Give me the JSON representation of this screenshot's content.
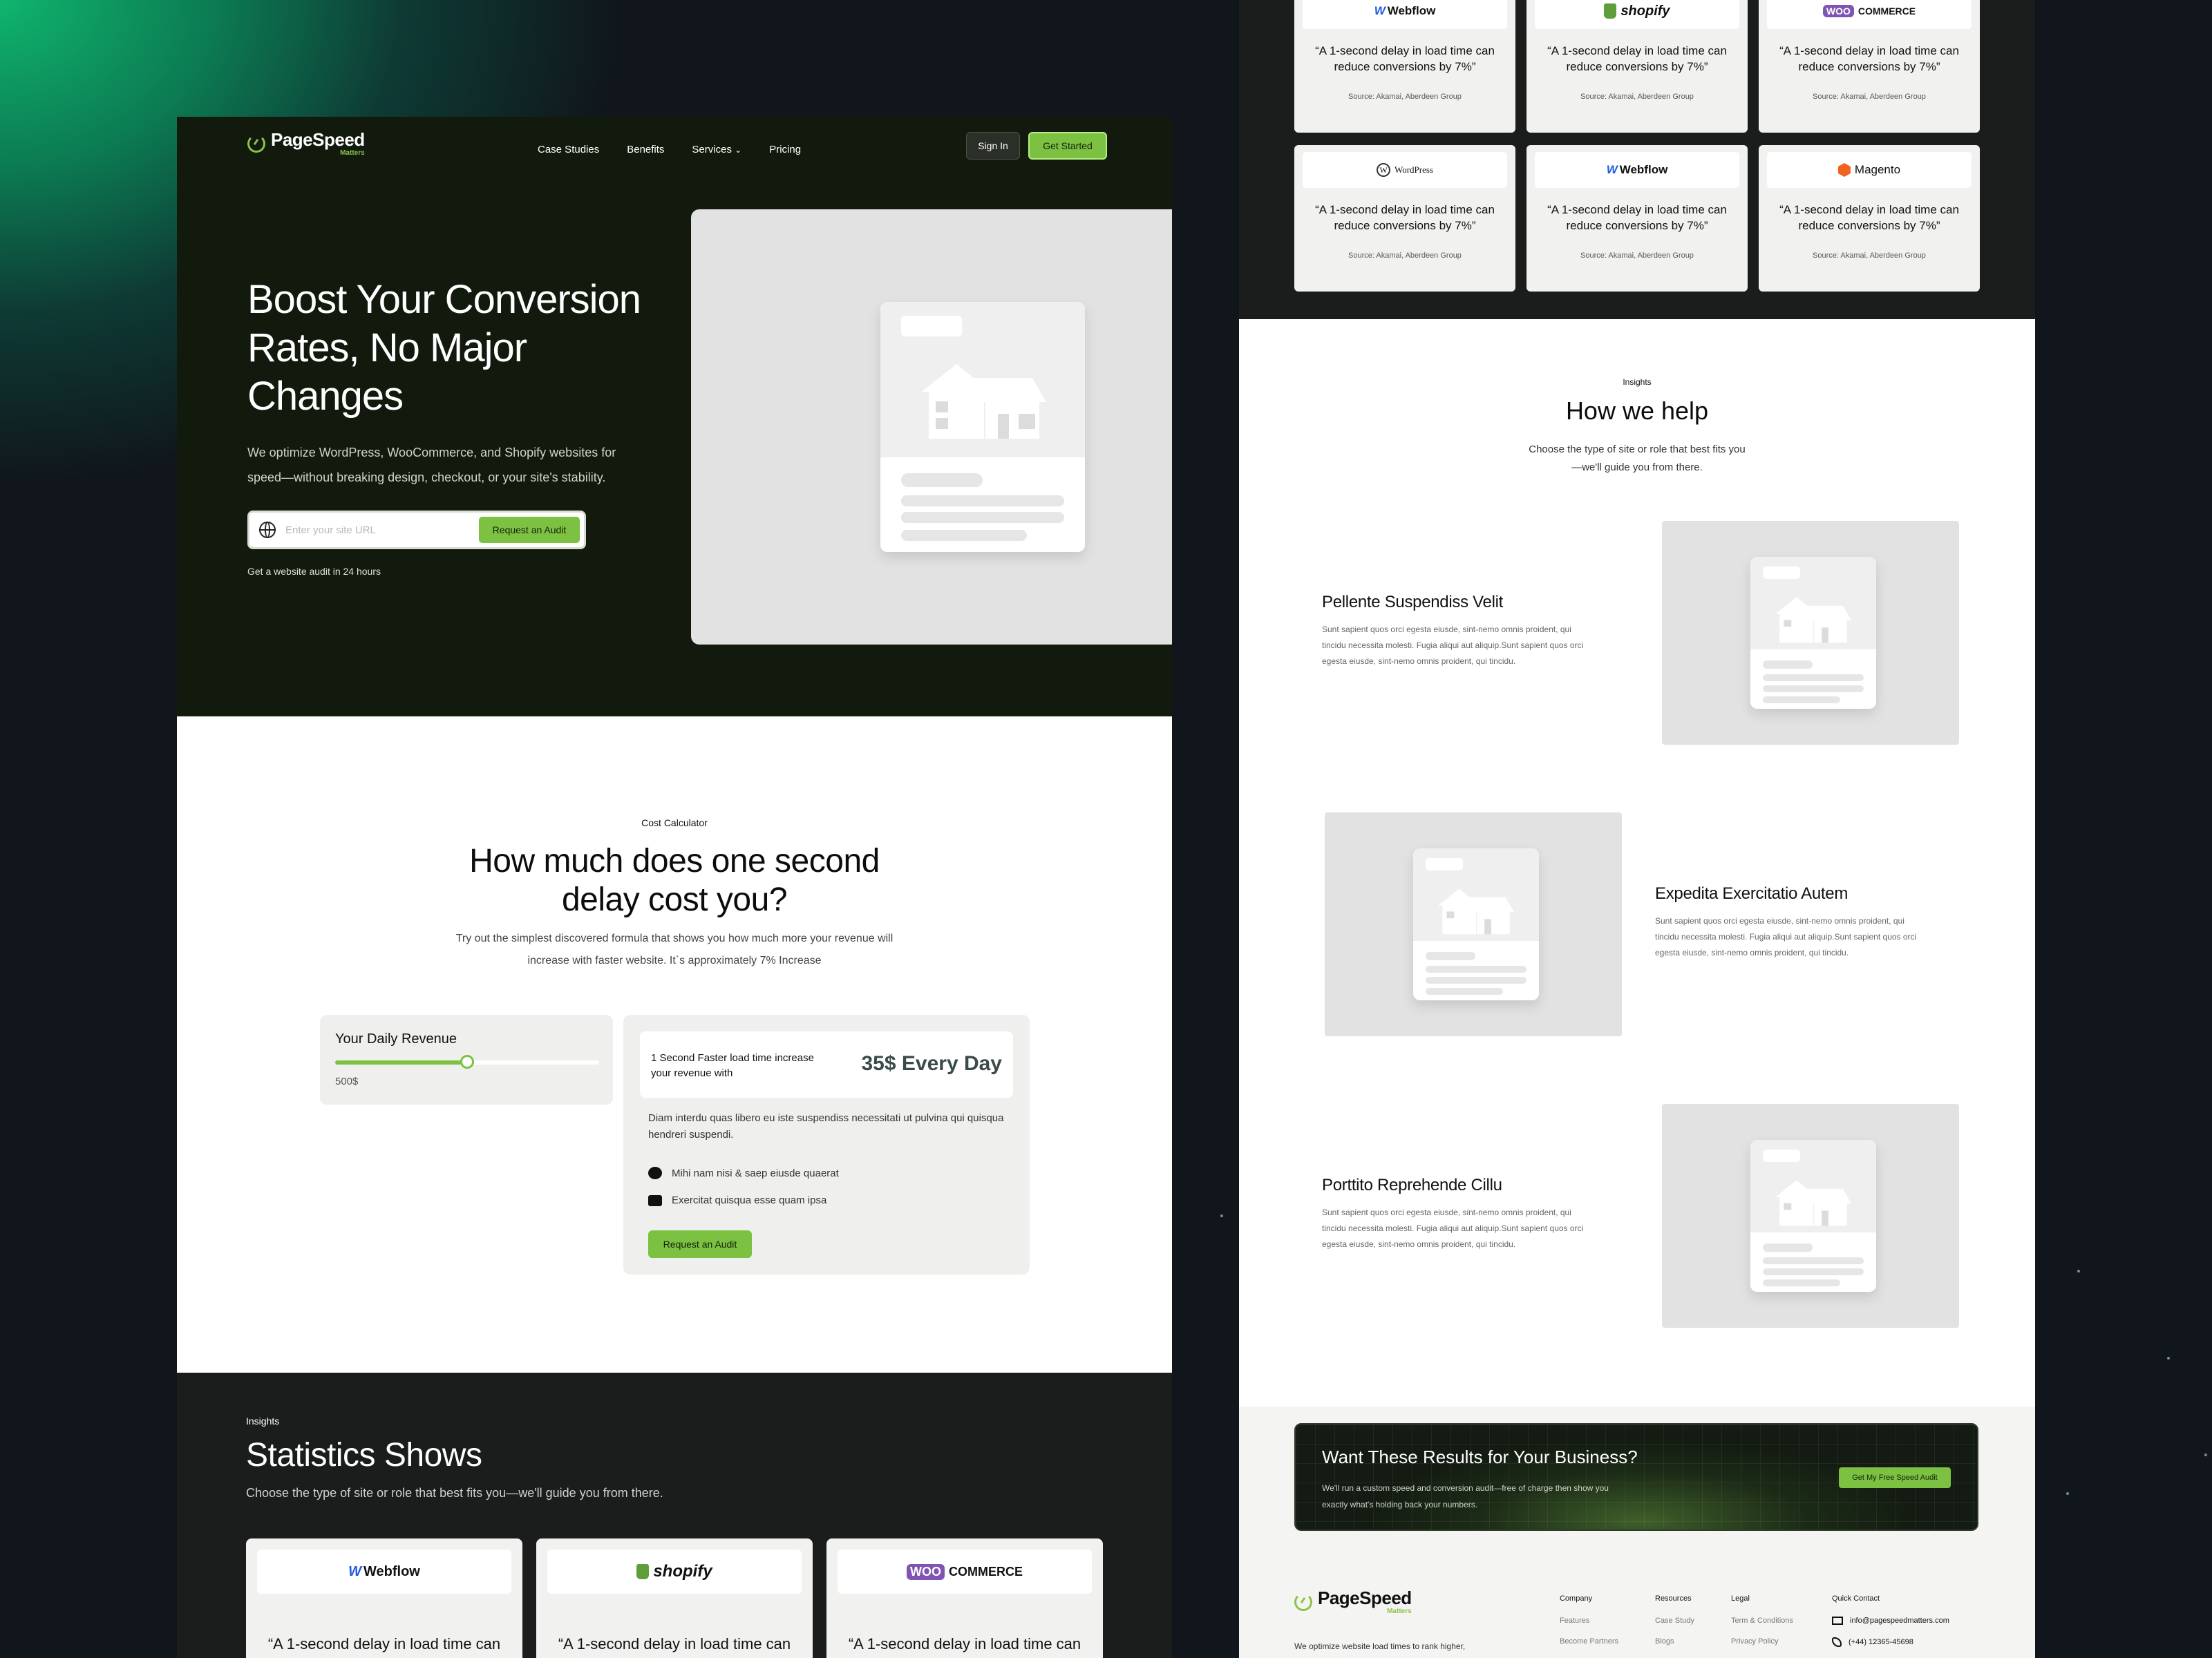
{
  "left": {
    "logo": {
      "name": "PageSpeed",
      "sub": "Matters"
    },
    "nav": {
      "items": [
        "Case Studies",
        "Benefits",
        "Services",
        "Pricing"
      ],
      "services_chevron": "⌄"
    },
    "header": {
      "signin": "Sign In",
      "get_started": "Get Started"
    },
    "hero": {
      "title": "Boost Your Conversion Rates, No Major Changes",
      "lead": "We optimize WordPress, WooCommerce, and Shopify websites for speed—without breaking design, checkout, or your site's stability.",
      "url_placeholder": "Enter your site URL",
      "audit_button": "Request an Audit",
      "note": "Get a website audit in 24 hours"
    },
    "calculator": {
      "eyebrow": "Cost Calculator",
      "title_line1": "How much does one second",
      "title_line2": "delay cost you?",
      "desc_line1": "Try out the simplest discovered formula that shows you how much more your revenue will",
      "desc_line2": "increase with faster website. It`s approximately 7% Increase",
      "revenue_label": "Your Daily Revenue",
      "revenue_value": "500$",
      "slider_fraction": 0.5,
      "result_line1": "1 Second Faster load time increase",
      "result_line2": "your revenue with",
      "result_amount": "35$ Every Day",
      "result_desc": "Diam interdu quas libero eu iste suspendiss necessitati ut pulvina qui quisqua hendreri suspendi.",
      "bullets": [
        "Mihi nam nisi & saep eiusde quaerat",
        "Exercitat quisqua esse quam ipsa"
      ],
      "button": "Request an Audit"
    },
    "stats": {
      "eyebrow": "Insights",
      "title": "Statistics Shows",
      "desc": "Choose the type of site or role that best fits you—we'll guide you from there.",
      "quote": "“A 1-second delay in load time can",
      "cards": [
        {
          "brand": "Webflow"
        },
        {
          "brand": "shopify"
        },
        {
          "brand": "COMMERCE",
          "prefix": "WOO"
        }
      ]
    }
  },
  "right": {
    "stat_cards": [
      {
        "brand": "Webflow",
        "quote_line1": "“A 1-second delay in load time can",
        "quote_line2": "reduce conversions by 7%”",
        "source": "Source: Akamai, Aberdeen Group"
      },
      {
        "brand": "shopify",
        "quote_line1": "“A 1-second delay in load time can",
        "quote_line2": "reduce conversions by 7%”",
        "source": "Source: Akamai, Aberdeen Group"
      },
      {
        "brand": "COMMERCE",
        "prefix": "WOO",
        "quote_line1": "“A 1-second delay in load time can",
        "quote_line2": "reduce conversions by 7%”",
        "source": "Source: Akamai, Aberdeen Group"
      },
      {
        "brand": "WordPress",
        "quote_line1": "“A 1-second delay in load time can",
        "quote_line2": "reduce conversions by 7%”",
        "source": "Source: Akamai, Aberdeen Group"
      },
      {
        "brand": "Webflow",
        "quote_line1": "“A 1-second delay in load time can",
        "quote_line2": "reduce conversions by 7%”",
        "source": "Source: Akamai, Aberdeen Group"
      },
      {
        "brand": "Magento",
        "quote_line1": "“A 1-second delay in load time can",
        "quote_line2": "reduce conversions by 7%”",
        "source": "Source: Akamai, Aberdeen Group"
      }
    ],
    "help": {
      "eyebrow": "Insights",
      "title": "How we help",
      "desc_line1": "Choose the type of site or role that best fits you",
      "desc_line2": "—we'll guide you from there.",
      "features": [
        {
          "title": "Pellente Suspendiss Velit",
          "text": "Sunt sapient quos orci egesta eiusde, sint-nemo omnis proident, qui tincidu necessita molesti. Fugia aliqui aut aliquip.Sunt sapient quos orci egesta eiusde, sint-nemo omnis proident, qui tincidu."
        },
        {
          "title": "Expedita Exercitatio Autem",
          "text": "Sunt sapient quos orci egesta eiusde, sint-nemo omnis proident, qui tincidu necessita molesti. Fugia aliqui aut aliquip.Sunt sapient quos orci egesta eiusde, sint-nemo omnis proident, qui tincidu."
        },
        {
          "title": "Porttito Reprehende Cillu",
          "text": "Sunt sapient quos orci egesta eiusde, sint-nemo omnis proident, qui tincidu necessita molesti. Fugia aliqui aut aliquip.Sunt sapient quos orci egesta eiusde, sint-nemo omnis proident, qui tincidu."
        }
      ]
    },
    "cta": {
      "title": "Want These Results for Your Business?",
      "text": "We'll run a custom speed and conversion audit—free of charge then show you exactly what's holding back your numbers.",
      "button": "Get My Free Speed Audit"
    },
    "footer": {
      "logo_name": "PageSpeed",
      "logo_sub": "Matters",
      "about": "We optimize website load times to rank higher,",
      "columns": [
        {
          "heading": "Company",
          "items": [
            "Features",
            "Become Partners"
          ]
        },
        {
          "heading": "Resources",
          "items": [
            "Case Study",
            "Blogs"
          ]
        },
        {
          "heading": "Legal",
          "items": [
            "Term & Conditions",
            "Privacy Policy"
          ]
        }
      ],
      "contact_heading": "Quick Contact",
      "email": "info@pagespeedmatters.com",
      "phone": "(+44) 12365-45698"
    }
  },
  "colors": {
    "accent": "#7cc142",
    "hero_bg": "#111a0d",
    "dark_section": "#1b1d1c",
    "placeholder": "#e2e2e2"
  }
}
